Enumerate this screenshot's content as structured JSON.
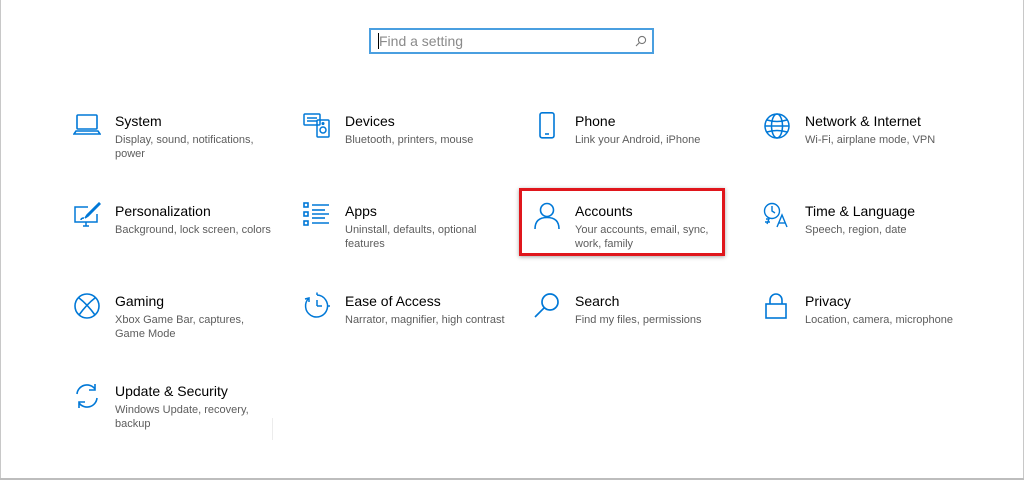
{
  "search": {
    "placeholder": "Find a setting",
    "icon": "search-icon"
  },
  "accent_color": "#0078d7",
  "highlight_color": "#e0161c",
  "highlighted_tile": "accounts",
  "tiles": [
    {
      "id": "system",
      "icon": "laptop-icon",
      "title": "System",
      "desc": "Display, sound, notifications, power"
    },
    {
      "id": "devices",
      "icon": "keyboard-speaker-icon",
      "title": "Devices",
      "desc": "Bluetooth, printers, mouse"
    },
    {
      "id": "phone",
      "icon": "phone-icon",
      "title": "Phone",
      "desc": "Link your Android, iPhone"
    },
    {
      "id": "network",
      "icon": "globe-icon",
      "title": "Network & Internet",
      "desc": "Wi-Fi, airplane mode, VPN"
    },
    {
      "id": "personalization",
      "icon": "paintbrush-display-icon",
      "title": "Personalization",
      "desc": "Background, lock screen, colors"
    },
    {
      "id": "apps",
      "icon": "apps-list-icon",
      "title": "Apps",
      "desc": "Uninstall, defaults, optional features"
    },
    {
      "id": "accounts",
      "icon": "person-icon",
      "title": "Accounts",
      "desc": "Your accounts, email, sync, work, family"
    },
    {
      "id": "time-language",
      "icon": "language-icon",
      "title": "Time & Language",
      "desc": "Speech, region, date"
    },
    {
      "id": "gaming",
      "icon": "xbox-icon",
      "title": "Gaming",
      "desc": "Xbox Game Bar, captures, Game Mode"
    },
    {
      "id": "ease-of-access",
      "icon": "ease-of-access-timer-icon",
      "title": "Ease of Access",
      "desc": "Narrator, magnifier, high contrast"
    },
    {
      "id": "search",
      "icon": "magnifier-icon",
      "title": "Search",
      "desc": "Find my files, permissions"
    },
    {
      "id": "privacy",
      "icon": "lock-icon",
      "title": "Privacy",
      "desc": "Location, camera, microphone"
    },
    {
      "id": "update-security",
      "icon": "sync-arrows-icon",
      "title": "Update & Security",
      "desc": "Windows Update, recovery, backup"
    }
  ]
}
